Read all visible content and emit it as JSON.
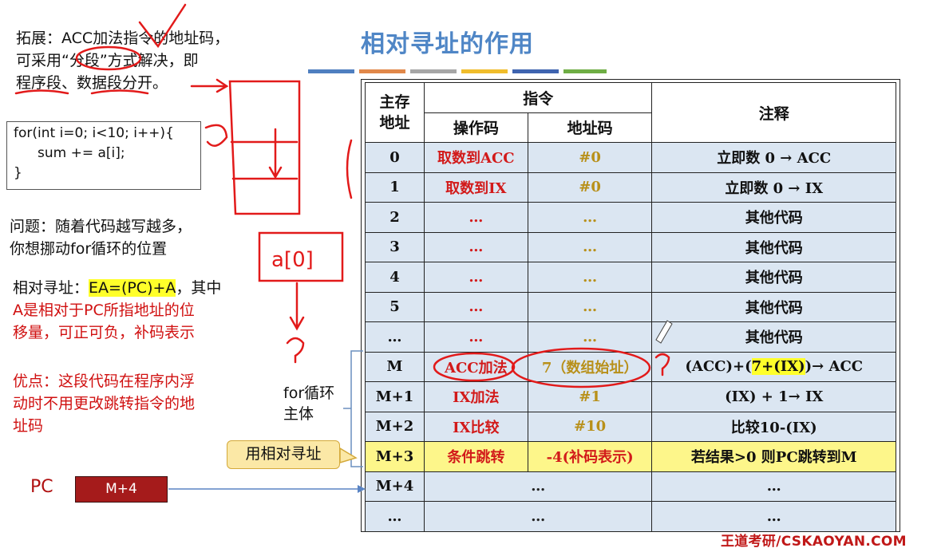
{
  "title": "相对寻址的作用",
  "accent_colors": [
    "#4f7fc0",
    "#e1884a",
    "#a6a6a6",
    "#f0bd2c",
    "#3f64b0",
    "#6fae45"
  ],
  "top_note": {
    "line1": "拓展：ACC加法指令的地址码，",
    "line2": "可采用“分段”方式解决，即",
    "line3": "程序段、数据段分开。"
  },
  "code": {
    "line1": "for(int i=0; i<10; i++){",
    "line2": "sum += a[i];",
    "line3": "}"
  },
  "question": {
    "line1": "问题：随着代码越写越多，",
    "line2": "你想挪动for循环的位置"
  },
  "relative": {
    "prefix": "相对寻址：",
    "formula": "EA=(PC)+A",
    "suffix": "，其中",
    "line2": "A是相对于PC所指地址的位",
    "line3_a": "移量，可正可负，",
    "line3_b": "补码表示"
  },
  "advantage": {
    "line1": "优点：这段代码在程序内浮",
    "line2": "动时不用更改跳转指令的地",
    "line3": "址码"
  },
  "for_body": {
    "line1": "for循环",
    "line2": "主体"
  },
  "callout": "用相对寻址",
  "pc": {
    "label": "PC",
    "value": "M+4"
  },
  "handwriting": {
    "box_text": "a[0]"
  },
  "table": {
    "headers": {
      "addr": "主存地址",
      "instr": "指令",
      "opcode": "操作码",
      "addrcode": "地址码",
      "note": "注释"
    },
    "rows": [
      {
        "addr": "0",
        "op": "取数到ACC",
        "ad": "#0",
        "note": "立即数 0 → ACC"
      },
      {
        "addr": "1",
        "op": "取数到IX",
        "ad": "#0",
        "note": "立即数 0 → IX"
      },
      {
        "addr": "2",
        "op": "…",
        "ad": "…",
        "note": "其他代码"
      },
      {
        "addr": "3",
        "op": "…",
        "ad": "…",
        "note": "其他代码"
      },
      {
        "addr": "4",
        "op": "…",
        "ad": "…",
        "note": "其他代码"
      },
      {
        "addr": "5",
        "op": "…",
        "ad": "…",
        "note": "其他代码"
      },
      {
        "addr": "…",
        "op": "…",
        "ad": "…",
        "note": "其他代码"
      },
      {
        "addr": "M",
        "op": "ACC加法",
        "ad": "7（数组始址）",
        "note_pre": "(ACC)+(",
        "note_mark": "7+(IX)",
        "note_post": ")→ ACC"
      },
      {
        "addr": "M+1",
        "op": "IX加法",
        "ad": "#1",
        "note": "(IX) + 1→ IX"
      },
      {
        "addr": "M+2",
        "op": "IX比较",
        "ad": "#10",
        "note": "比较10-(IX)"
      },
      {
        "addr": "M+3",
        "op": "条件跳转",
        "ad": "-4(补码表示)",
        "note": "若结果>0 则PC跳转到M"
      },
      {
        "addr": "M+4",
        "span": "…",
        "note": "…"
      },
      {
        "addr": "…",
        "span": "…",
        "note": "…"
      }
    ]
  },
  "footer": "王道考研/CSKAOYAN.COM"
}
